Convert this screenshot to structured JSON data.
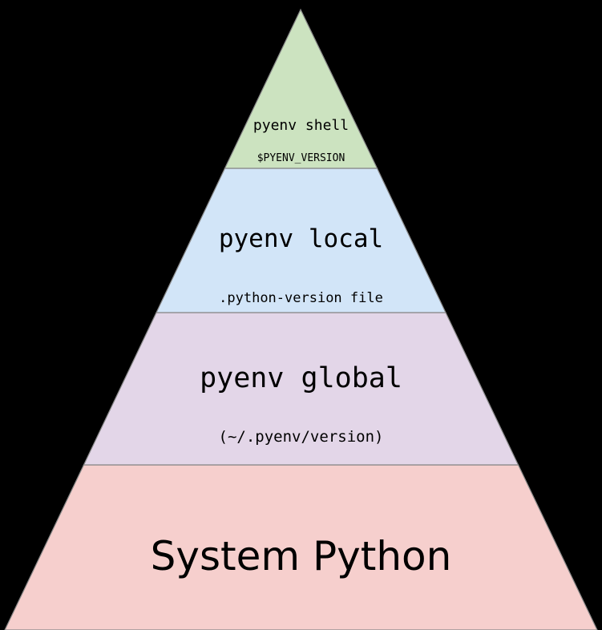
{
  "pyramid": {
    "layers": [
      {
        "title": "pyenv shell",
        "subtitle": "$PYENV_VERSION",
        "fill": "#cce3c0",
        "stroke": "#888888"
      },
      {
        "title": "pyenv local",
        "subtitle": ".python-version file",
        "fill": "#d2e5f8",
        "stroke": "#888888"
      },
      {
        "title": "pyenv global",
        "subtitle": "(~/.pyenv/version)",
        "fill": "#e3d6e8",
        "stroke": "#888888"
      },
      {
        "title": "System Python",
        "subtitle": "",
        "fill": "#f6cfcd",
        "stroke": "#888888"
      }
    ]
  }
}
